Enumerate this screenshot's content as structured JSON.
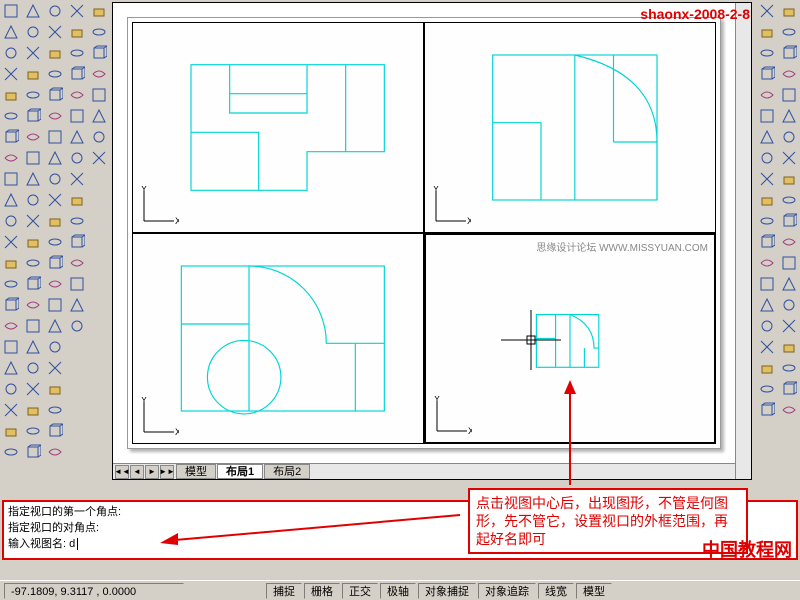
{
  "watermarks": {
    "top_right": "shaonx-2008-2-8",
    "mid": "思缘设计论坛   WWW.MISSYUAN.COM",
    "bottom_right": "中国教程网"
  },
  "tabs": {
    "model": "模型",
    "layout1": "布局1",
    "layout2": "布局2"
  },
  "command": {
    "line1": "指定视口的第一个角点:",
    "line2": "指定视口的对角点:",
    "prompt": "输入视图名:",
    "input": "d"
  },
  "annotation": {
    "text": "点击视图中心后，出现图形，不管是何图形，先不管它，设置视口的外框范围，再起好名即可"
  },
  "status": {
    "coords": "-97.1809, 9.3117 , 0.0000",
    "snap": "捕捉",
    "grid": "栅格",
    "ortho": "正交",
    "polar": "极轴",
    "osnap": "对象捕捉",
    "otrack": "对象追踪",
    "lwt": "线宽",
    "model": "模型"
  },
  "icons": {
    "left_tools": [
      "line",
      "box",
      "revolve",
      "polyline",
      "cylinder",
      "sphere",
      "extrude",
      "cone",
      "torus",
      "wedge",
      "region",
      "subtract",
      "union",
      "intersect",
      "slice",
      "section",
      "interfere",
      "setup-view",
      "setup-drawing",
      "setup-profile",
      "solids-edit"
    ],
    "right_tools": [
      "new",
      "open",
      "save",
      "print",
      "cut",
      "copy",
      "paste",
      "match",
      "undo",
      "redo",
      "line",
      "pline",
      "polygon",
      "rectangle",
      "arc",
      "circle",
      "spline",
      "ellipse",
      "hatch",
      "point",
      "text",
      "dim"
    ]
  }
}
